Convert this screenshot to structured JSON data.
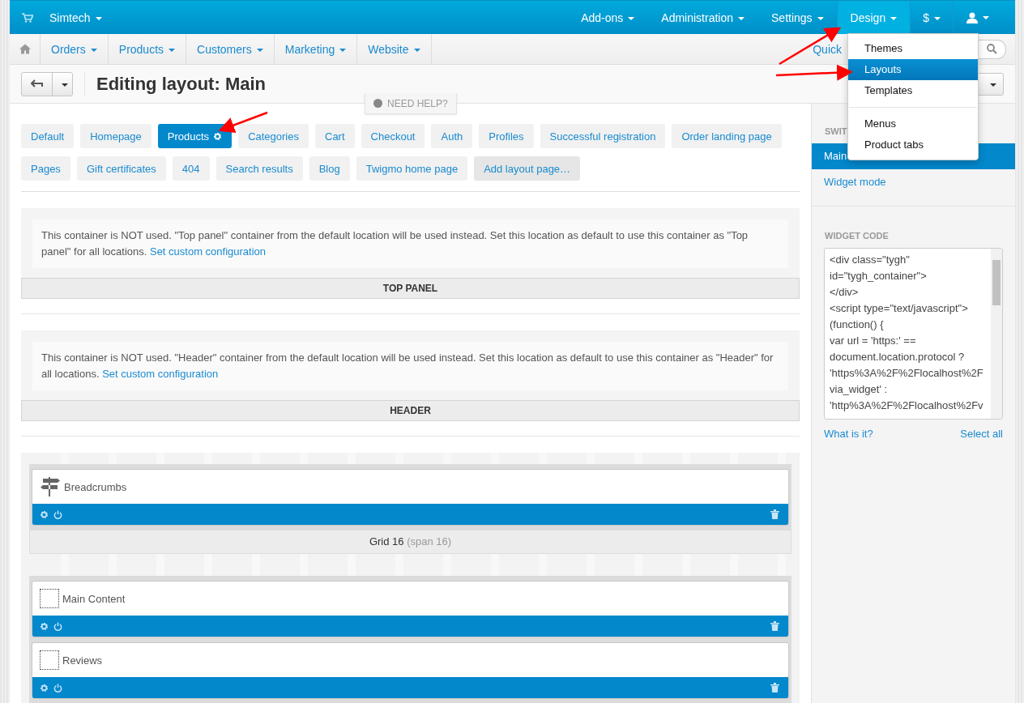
{
  "topbar": {
    "store": "Simtech",
    "menus": [
      {
        "kind": "text",
        "label": "Add-ons",
        "selected": false
      },
      {
        "kind": "text",
        "label": "Administration",
        "selected": false
      },
      {
        "kind": "text",
        "label": "Settings",
        "selected": false
      },
      {
        "kind": "text",
        "label": "Design",
        "selected": true
      },
      {
        "kind": "text",
        "label": "$",
        "selected": false
      },
      {
        "kind": "user",
        "selected": false
      }
    ]
  },
  "subnav": {
    "items": [
      "Orders",
      "Products",
      "Customers",
      "Marketing",
      "Website"
    ],
    "quick_link": "Quick"
  },
  "page": {
    "title": "Editing layout: Main",
    "help": "NEED HELP?"
  },
  "dropdown": {
    "groups": [
      [
        {
          "label": "Themes",
          "selected": false
        },
        {
          "label": "Layouts",
          "selected": true
        },
        {
          "label": "Templates",
          "selected": false
        }
      ],
      [
        {
          "label": "Menus",
          "selected": false
        },
        {
          "label": "Product tabs",
          "selected": false
        }
      ]
    ]
  },
  "layout_tabs": [
    {
      "kind": "page",
      "label": "Default",
      "selected": false
    },
    {
      "kind": "page",
      "label": "Homepage",
      "selected": false
    },
    {
      "kind": "page",
      "label": "Products",
      "selected": true
    },
    {
      "kind": "page",
      "label": "Categories",
      "selected": false
    },
    {
      "kind": "page",
      "label": "Cart",
      "selected": false
    },
    {
      "kind": "page",
      "label": "Checkout",
      "selected": false
    },
    {
      "kind": "page",
      "label": "Auth",
      "selected": false
    },
    {
      "kind": "page",
      "label": "Profiles",
      "selected": false
    },
    {
      "kind": "page",
      "label": "Successful registration",
      "selected": false
    },
    {
      "kind": "page",
      "label": "Order landing page",
      "selected": false
    },
    {
      "kind": "page",
      "label": "Pages",
      "selected": false
    },
    {
      "kind": "page",
      "label": "Gift certificates",
      "selected": false
    },
    {
      "kind": "page",
      "label": "404",
      "selected": false
    },
    {
      "kind": "page",
      "label": "Search results",
      "selected": false
    },
    {
      "kind": "page",
      "label": "Blog",
      "selected": false
    },
    {
      "kind": "page",
      "label": "Twigmo home page",
      "selected": false
    },
    {
      "kind": "add",
      "label": "Add layout page…",
      "selected": false
    }
  ],
  "containers": [
    {
      "notice": "This container is NOT used. \"Top panel\" container from the default location will be used instead. Set this location as default to use this container as \"Top panel\" for all locations.",
      "link": "Set custom configuration",
      "title": "TOP PANEL"
    },
    {
      "notice": "This container is NOT used. \"Header\" container from the default location will be used instead. Set this location as default to use this container as \"Header\" for all locations.",
      "link": "Set custom configuration",
      "title": "HEADER"
    }
  ],
  "grids": [
    {
      "blocks": [
        {
          "kind": "signpost",
          "name": "Breadcrumbs"
        }
      ],
      "label": "Grid 16",
      "span": "(span 16)"
    },
    {
      "blocks": [
        {
          "kind": "placeholder",
          "name": "Main Content"
        },
        {
          "kind": "placeholder",
          "name": "Reviews"
        }
      ]
    }
  ],
  "sidebar": {
    "heading": "SWIT",
    "switch_items": [
      {
        "label": "Main",
        "selected": true
      },
      {
        "label": "Widget mode",
        "selected": false
      }
    ],
    "widget_heading": "WIDGET CODE",
    "code_lines": [
      "<div class=\"tygh\"",
      "id=\"tygh_container\">",
      "</div>",
      "<script type=\"text/javascript\">",
      "(function() {",
      "var url = 'https:' ==",
      "document.location.protocol ?",
      "'https%3A%2F%2Flocalhost%2F",
      "via_widget' :",
      "'http%3A%2F%2Flocalhost%2Fv"
    ],
    "links": [
      "What is it?",
      "Select all"
    ]
  }
}
